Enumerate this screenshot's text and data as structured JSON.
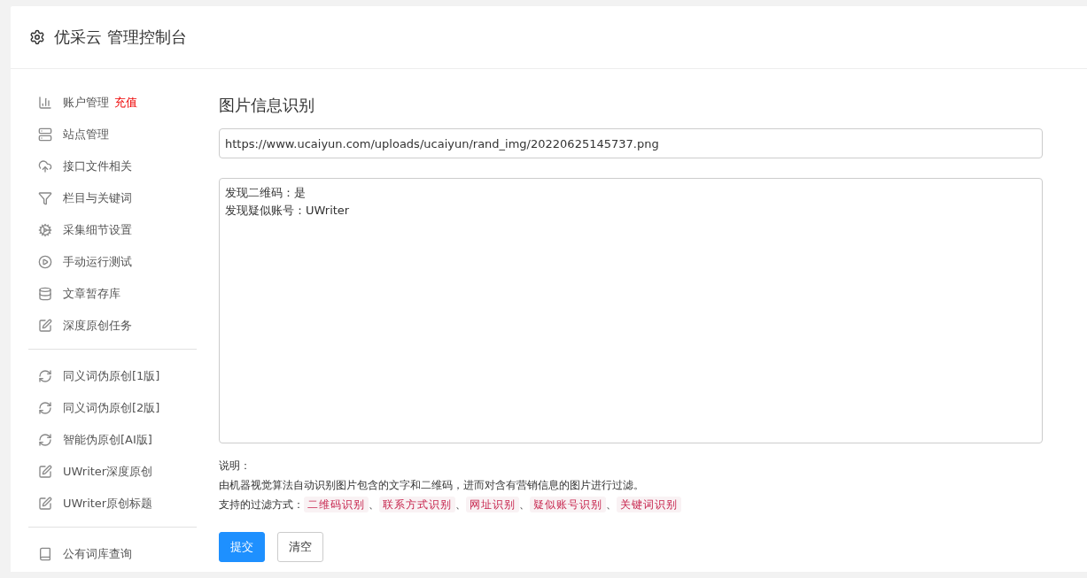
{
  "header": {
    "title": "优采云 管理控制台"
  },
  "sidebar": {
    "groups": [
      {
        "items": [
          {
            "kind": "chart",
            "label": "账户管理",
            "badge": "充值"
          },
          {
            "kind": "server",
            "label": "站点管理"
          },
          {
            "kind": "upload",
            "label": "接口文件相关"
          },
          {
            "kind": "filter",
            "label": "栏目与关键词"
          },
          {
            "kind": "cogs",
            "label": "采集细节设置"
          },
          {
            "kind": "play",
            "label": "手动运行测试"
          },
          {
            "kind": "database",
            "label": "文章暂存库"
          },
          {
            "kind": "edit",
            "label": "深度原创任务"
          }
        ]
      },
      {
        "items": [
          {
            "kind": "refresh",
            "label": "同义词伪原创[1版]"
          },
          {
            "kind": "refresh",
            "label": "同义词伪原创[2版]"
          },
          {
            "kind": "refresh",
            "label": "智能伪原创[AI版]"
          },
          {
            "kind": "edit",
            "label": "UWriter深度原创"
          },
          {
            "kind": "edit",
            "label": "UWriter原创标题"
          }
        ]
      },
      {
        "items": [
          {
            "kind": "book",
            "label": "公有词库查询"
          }
        ]
      }
    ]
  },
  "main": {
    "title": "图片信息识别",
    "url_field": {
      "value": "https://www.ucaiyun.com/uploads/ucaiyun/rand_img/20220625145737.png"
    },
    "result_box": {
      "lines": [
        "发现二维码：是",
        "发现疑似账号：UWriter"
      ]
    },
    "notes": {
      "heading": "说明：",
      "description": "由机器视觉算法自动识别图片包含的文字和二维码，进而对含有营销信息的图片进行过滤。",
      "methods_label": "支持的过滤方式：",
      "separator": "、",
      "methods": [
        "二维码识别",
        "联系方式识别",
        "网址识别",
        "疑似账号识别",
        "关键词识别"
      ]
    },
    "buttons": [
      {
        "label": "提交",
        "kind": "primary"
      },
      {
        "label": "清空",
        "kind": "default"
      }
    ]
  }
}
